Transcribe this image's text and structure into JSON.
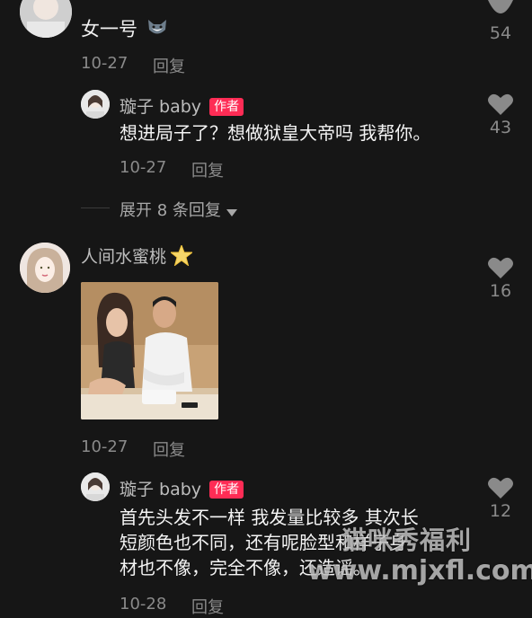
{
  "comments": [
    {
      "name": "女一号",
      "date": "10-27",
      "reply_label": "回复",
      "likes": "54"
    },
    {
      "name": "璇子 baby",
      "badge": "作者",
      "text": "想进局子了？想做狱皇大帝吗 我帮你。",
      "date": "10-27",
      "reply_label": "回复",
      "likes": "43"
    },
    {
      "expand_label": "展开 8 条回复"
    },
    {
      "name": "人间水蜜桃",
      "date": "10-27",
      "reply_label": "回复",
      "likes": "16"
    },
    {
      "name": "璇子 baby",
      "badge": "作者",
      "text_line1": "首先头发不一样 我发量比较多 其次长",
      "text_line2": "短颜色也不同，还有呢脸型和样子身",
      "text_line3": "材也不像，完全不像，还造谣。",
      "date": "10-28",
      "reply_label": "回复",
      "likes": "12"
    }
  ],
  "watermark": {
    "line1": "猫咪秀福利",
    "line2": "www.mjxfl.com"
  },
  "colors": {
    "background": "#161616",
    "badge": "#fe2c55",
    "heart": "#8a8a8a"
  }
}
